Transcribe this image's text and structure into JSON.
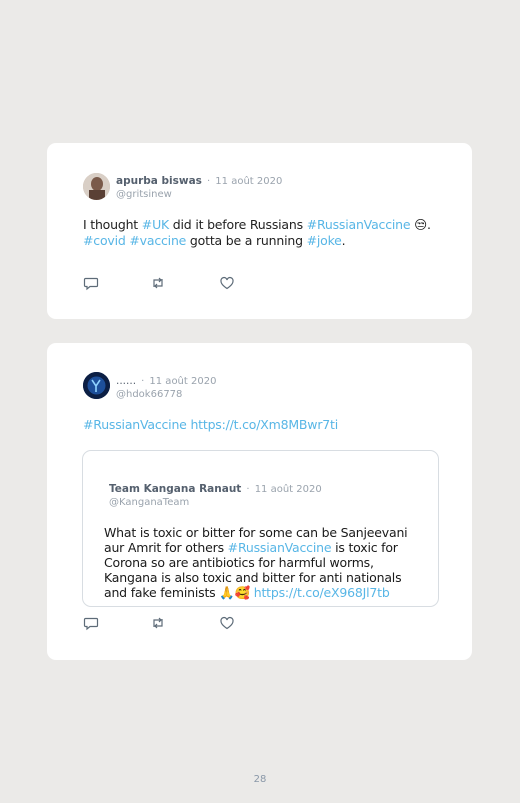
{
  "tweets": [
    {
      "author_name": "apurba biswas",
      "date": "11 août 2020",
      "handle": "@gritsinew",
      "text": [
        {
          "t": "I thought ",
          "tag": false
        },
        {
          "t": "#UK",
          "tag": true
        },
        {
          "t": " did it before Russians ",
          "tag": false
        },
        {
          "t": "#RussianVaccine",
          "tag": true
        },
        {
          "t": " 😒. ",
          "tag": false
        },
        {
          "t": "#covid",
          "tag": true
        },
        {
          "t": " ",
          "tag": false
        },
        {
          "t": "#vaccine",
          "tag": true
        },
        {
          "t": " gotta be a running ",
          "tag": false
        },
        {
          "t": "#joke",
          "tag": true
        },
        {
          "t": ".",
          "tag": false
        }
      ]
    },
    {
      "author_name": "......",
      "date": "11 août 2020",
      "handle": "@hdok66778",
      "text": [
        {
          "t": "#RussianVaccine https://t.co/Xm8MBwr7ti",
          "tag": true
        }
      ],
      "quote": {
        "author_name": "Team Kangana Ranaut",
        "date": "11 août 2020",
        "handle": "@KanganaTeam",
        "text": [
          {
            "t": "What is toxic or bitter for some can be Sanjeevani aur Amrit for others ",
            "tag": false
          },
          {
            "t": "#RussianVaccine",
            "tag": true
          },
          {
            "t": " is toxic for Corona so are antibiotics for harmful worms, Kangana is also toxic and bitter for anti nationals and fake feminists 🙏🥰 ",
            "tag": false
          },
          {
            "t": "https://t.co/eX968Jl7tb",
            "tag": true
          }
        ]
      }
    }
  ],
  "separator": "·",
  "icons": {
    "reply": "reply-icon",
    "retweet": "retweet-icon",
    "like": "like-icon"
  },
  "colors": {
    "hashtag": "#58b6e6",
    "card": "#ffffff",
    "page": "#ebeae8"
  },
  "page_number": "28"
}
